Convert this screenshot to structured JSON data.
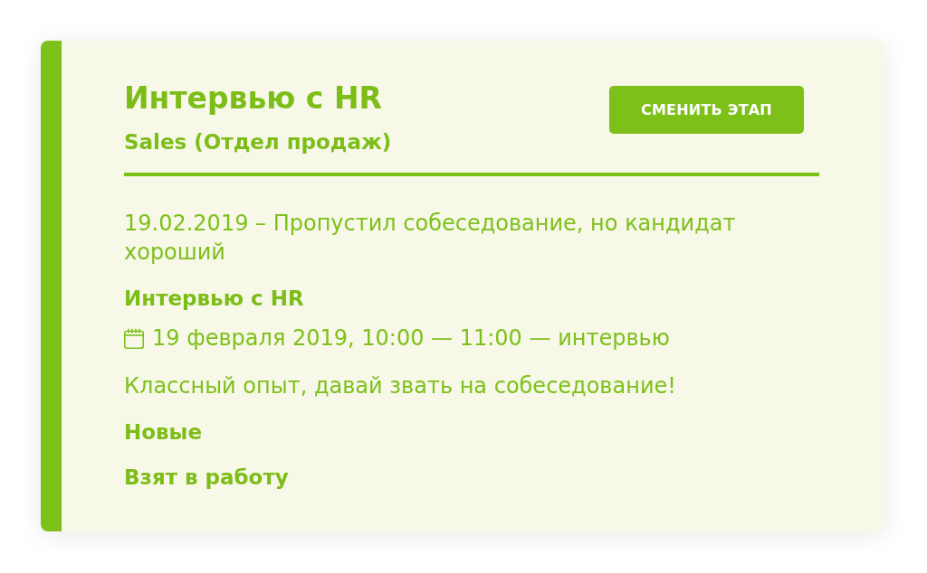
{
  "card": {
    "stage_title": "Интервью с HR",
    "department": "Sales (Отдел продаж)",
    "change_stage_button": "СМЕНИТЬ ЭТАП",
    "entries": [
      {
        "kind": "note",
        "text": "19.02.2019 – Пропустил собеседование, но кандидат хороший"
      },
      {
        "kind": "heading",
        "text": "Интервью с HR"
      },
      {
        "kind": "event",
        "text": "19 февраля 2019, 10:00 — 11:00 — интервью"
      },
      {
        "kind": "note",
        "text": "Классный опыт, давай звать на собеседование!"
      },
      {
        "kind": "heading",
        "text": "Новые"
      },
      {
        "kind": "heading",
        "text": "Взят в работу"
      }
    ]
  }
}
